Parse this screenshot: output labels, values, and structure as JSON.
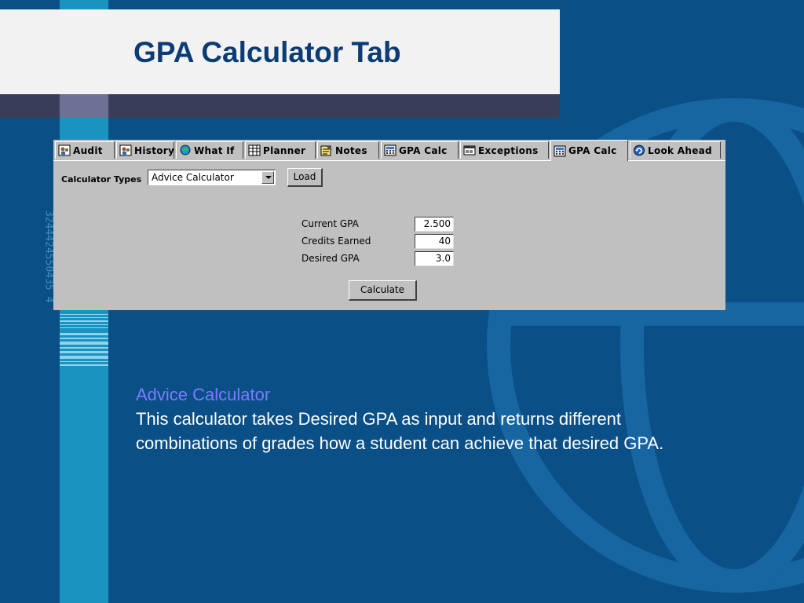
{
  "slide": {
    "title": "GPA Calculator Tab",
    "side_digits": "3244424550435 4",
    "description_heading": "Advice Calculator",
    "description_body": "This calculator takes Desired GPA as input and returns different combinations of grades how a student can achieve that desired GPA."
  },
  "tabs": [
    {
      "label": "Audit",
      "icon": "audit-icon"
    },
    {
      "label": "History",
      "icon": "history-icon"
    },
    {
      "label": "What If",
      "icon": "what-if-icon"
    },
    {
      "label": "Planner",
      "icon": "planner-icon"
    },
    {
      "label": "Notes",
      "icon": "notes-icon"
    },
    {
      "label": "GPA Calc",
      "icon": "calculator-icon"
    },
    {
      "label": "Exceptions",
      "icon": "exceptions-icon"
    },
    {
      "label": "GPA Calc",
      "icon": "calculator-icon",
      "active": true
    },
    {
      "label": "Look Ahead",
      "icon": "look-ahead-icon"
    }
  ],
  "form": {
    "calculator_types_label": "Calculator Types",
    "calculator_type_value": "Advice Calculator",
    "load_label": "Load",
    "current_gpa_label": "Current GPA",
    "current_gpa_value": "2.500",
    "credits_earned_label": "Credits Earned",
    "credits_earned_value": "40",
    "desired_gpa_label": "Desired GPA",
    "desired_gpa_value": "3.0",
    "calculate_label": "Calculate"
  },
  "colors": {
    "background": "#0a4f86",
    "title": "#0b3c73",
    "heading_accent": "#7b7bff",
    "stripe": "#1a93c0"
  }
}
